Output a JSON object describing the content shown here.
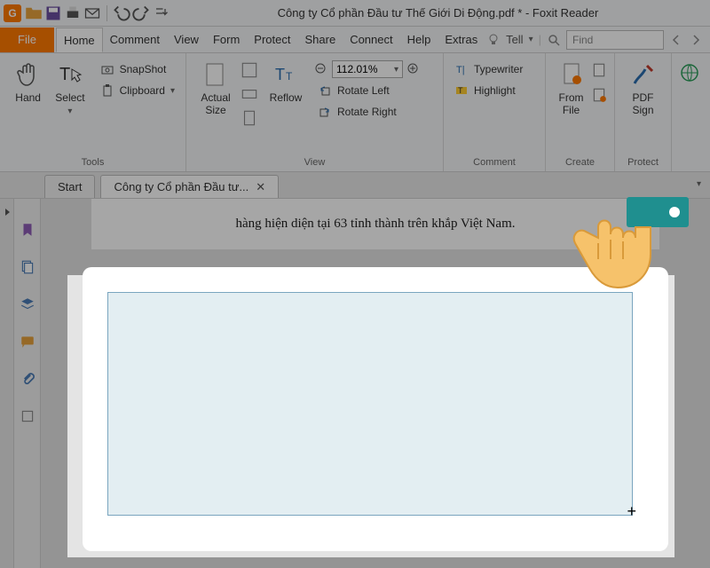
{
  "app": {
    "title": "Công ty Cổ phần Đầu tư Thế Giới Di Động.pdf * - Foxit Reader"
  },
  "qat": {
    "open": "Open",
    "save": "Save",
    "print": "Print",
    "email": "Email"
  },
  "menus": {
    "file": "File",
    "items": [
      "Home",
      "Comment",
      "View",
      "Form",
      "Protect",
      "Share",
      "Connect",
      "Help",
      "Extras"
    ],
    "tell": "Tell",
    "find_placeholder": "Find"
  },
  "ribbon": {
    "tools": {
      "label": "Tools",
      "hand": "Hand",
      "select": "Select",
      "snapshot": "SnapShot",
      "clipboard": "Clipboard"
    },
    "view": {
      "label": "View",
      "actual_size": "Actual\nSize",
      "reflow": "Reflow",
      "zoom_value": "112.01%",
      "rotate_left": "Rotate Left",
      "rotate_right": "Rotate Right"
    },
    "comment": {
      "label": "Comment",
      "typewriter": "Typewriter",
      "highlight": "Highlight"
    },
    "create": {
      "label": "Create",
      "from_file": "From\nFile"
    },
    "protect": {
      "label": "Protect",
      "pdf_sign": "PDF\nSign"
    }
  },
  "tabs": {
    "start": "Start",
    "doc": "Công ty Cổ phần Đầu tư..."
  },
  "document": {
    "line": "hàng hiện diện tại 63 tỉnh thành trên khắp Việt Nam."
  },
  "side_icons": [
    "bookmark",
    "pages",
    "layers",
    "comments",
    "attachments",
    "signatures"
  ]
}
